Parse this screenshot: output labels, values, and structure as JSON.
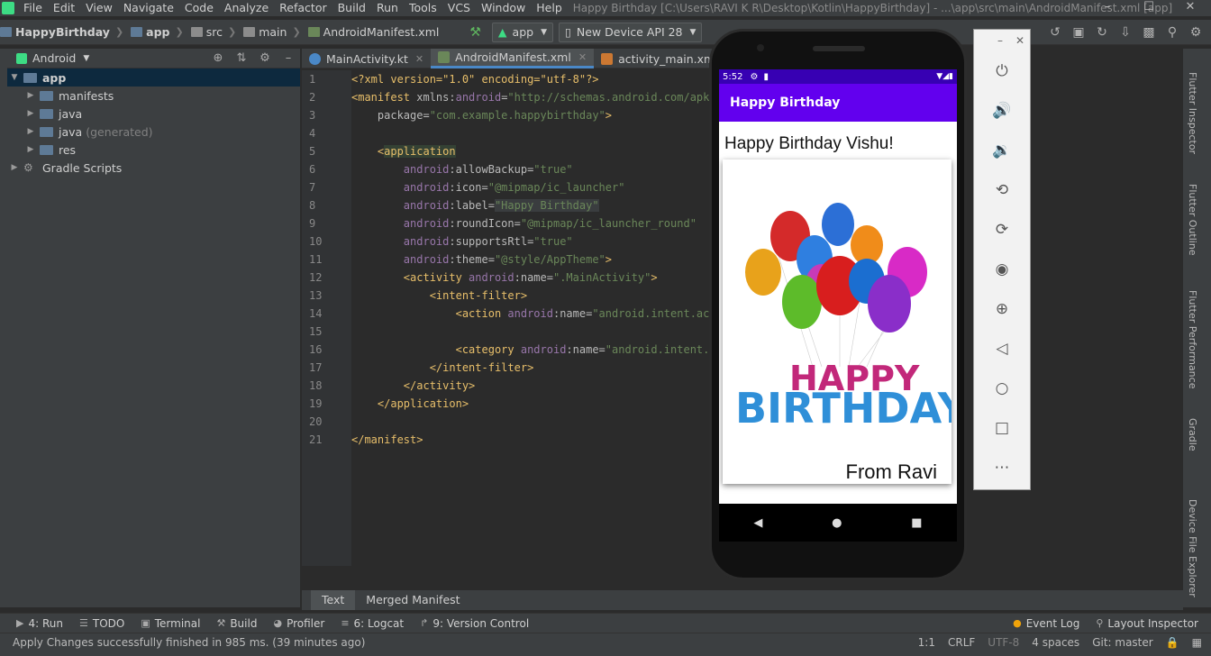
{
  "menu": [
    "File",
    "Edit",
    "View",
    "Navigate",
    "Code",
    "Analyze",
    "Refactor",
    "Build",
    "Run",
    "Tools",
    "VCS",
    "Window",
    "Help"
  ],
  "window_title": "Happy Birthday [C:\\Users\\RAVI K R\\Desktop\\Kotlin\\HappyBirthday] - ...\\app\\src\\main\\AndroidManifest.xml [app]",
  "breadcrumb": [
    "HappyBirthday",
    "app",
    "src",
    "main",
    "AndroidManifest.xml"
  ],
  "run_config": "app",
  "device": "New Device API 28",
  "project_view": "Android",
  "tree": [
    {
      "label": "app",
      "extra": "",
      "indent": 0,
      "expanded": true,
      "selected": true,
      "type": "folder"
    },
    {
      "label": "manifests",
      "extra": "",
      "indent": 1,
      "expanded": false,
      "selected": false,
      "type": "folder"
    },
    {
      "label": "java",
      "extra": "",
      "indent": 1,
      "expanded": false,
      "selected": false,
      "type": "folder"
    },
    {
      "label": "java",
      "extra": "(generated)",
      "indent": 1,
      "expanded": false,
      "selected": false,
      "type": "folder"
    },
    {
      "label": "res",
      "extra": "",
      "indent": 1,
      "expanded": false,
      "selected": false,
      "type": "folder"
    },
    {
      "label": "Gradle Scripts",
      "extra": "",
      "indent": 0,
      "expanded": false,
      "selected": false,
      "type": "gradle"
    }
  ],
  "editor_tabs": [
    {
      "label": "MainActivity.kt",
      "active": false,
      "color": "#4a88c7"
    },
    {
      "label": "AndroidManifest.xml",
      "active": true,
      "color": "#6a8759"
    },
    {
      "label": "activity_main.xml",
      "active": false,
      "color": "#cc7832"
    }
  ],
  "line_numbers": [
    "1",
    "2",
    "3",
    "4",
    "5",
    "6",
    "7",
    "8",
    "9",
    "10",
    "11",
    "12",
    "13",
    "14",
    "15",
    "16",
    "17",
    "18",
    "19",
    "20",
    "21"
  ],
  "code": {
    "l1": "<?xml version=\"1.0\" encoding=\"utf-8\"?>",
    "l2a": "<manifest ",
    "l2b": "xmlns:",
    "l2c": "android",
    "l2d": "=",
    "l2e": "\"http://schemas.android.com/apk/",
    "l3a": "    package=",
    "l3b": "\"com.example.happybirthday\"",
    "l3c": ">",
    "l5a": "    <",
    "l5b": "application",
    "l6a": "        android",
    "l6b": ":allowBackup=",
    "l6c": "\"true\"",
    "l7a": "        android",
    "l7b": ":icon=",
    "l7c": "\"@mipmap/ic_launcher\"",
    "l8a": "        android",
    "l8b": ":label=",
    "l8c": "\"Happy Birthday\"",
    "l9a": "        android",
    "l9b": ":roundIcon=",
    "l9c": "\"@mipmap/ic_launcher_round\"",
    "l10a": "        android",
    "l10b": ":supportsRtl=",
    "l10c": "\"true\"",
    "l11a": "        android",
    "l11b": ":theme=",
    "l11c": "\"@style/AppTheme\"",
    "l11d": ">",
    "l12a": "        <activity ",
    "l12b": "android",
    "l12c": ":name=",
    "l12d": "\".MainActivity\"",
    "l12e": ">",
    "l13": "            <intent-filter>",
    "l14a": "                <action ",
    "l14b": "android",
    "l14c": ":name=",
    "l14d": "\"android.intent.act",
    "l16a": "                <category ",
    "l16b": "android",
    "l16c": ":name=",
    "l16d": "\"android.intent.c",
    "l17": "            </intent-filter>",
    "l18": "        </activity>",
    "l19": "    </application>",
    "l21": "</manifest>"
  },
  "editor_bottom_tabs": [
    "Text",
    "Merged Manifest"
  ],
  "phone": {
    "time": "5:52",
    "app_title": "Happy Birthday",
    "greeting": "Happy Birthday Vishu!",
    "image_text_1": "HAPPY",
    "image_text_2": "BIRTHDAY",
    "from": "From Ravi"
  },
  "right_tools": [
    "Flutter Inspector",
    "Flutter Outline",
    "Flutter Performance",
    "Gradle",
    "Device File Explorer"
  ],
  "tool_tabs": [
    "4: Run",
    "TODO",
    "Terminal",
    "Build",
    "Profiler",
    "6: Logcat",
    "9: Version Control"
  ],
  "tool_tabs_right": [
    "Event Log",
    "Layout Inspector"
  ],
  "status": {
    "message": "Apply Changes successfully finished in 985 ms. (39 minutes ago)",
    "position": "1:1",
    "line_sep": "CRLF",
    "encoding": "UTF-8",
    "indent": "4 spaces",
    "git": "Git: master"
  }
}
